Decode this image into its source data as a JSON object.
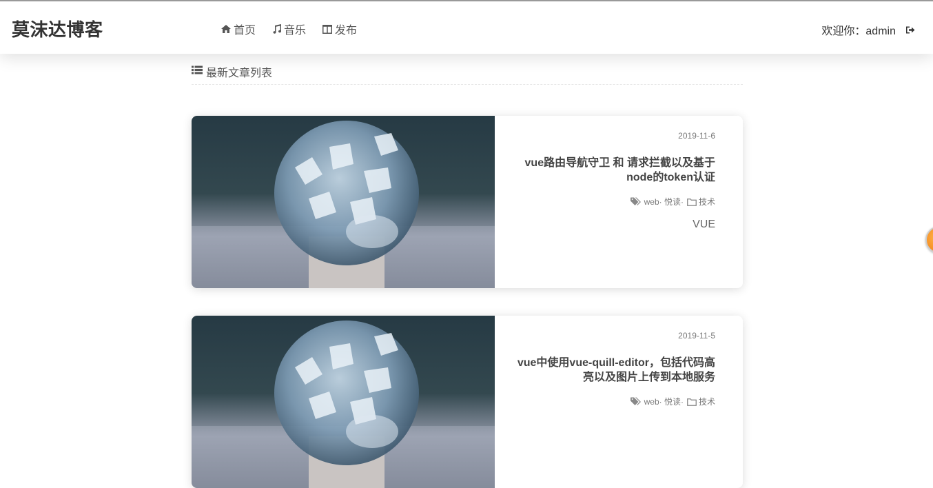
{
  "header": {
    "logo": "莫沫达博客",
    "nav": [
      {
        "label": "首页",
        "icon": "home-icon"
      },
      {
        "label": "音乐",
        "icon": "music-icon"
      },
      {
        "label": "发布",
        "icon": "columns-icon"
      }
    ],
    "welcome": "欢迎你：admin",
    "logout_icon": "sign-out-icon"
  },
  "section": {
    "title": "最新文章列表",
    "icon": "list-icon"
  },
  "posts": [
    {
      "date": "2019-11-6",
      "title": "vue路由导航守卫 和 请求拦截以及基于node的token认证",
      "tags": "web· 悦读·",
      "category": "技术",
      "summary": "VUE"
    },
    {
      "date": "2019-11-5",
      "title": "vue中使用vue-quill-editor，包括代码高亮以及图片上传到本地服务",
      "tags": "web· 悦读·",
      "category": "技术",
      "summary": ""
    }
  ],
  "colors": {
    "text": "#555555",
    "title": "#444444",
    "float_button": "#f07a10"
  }
}
